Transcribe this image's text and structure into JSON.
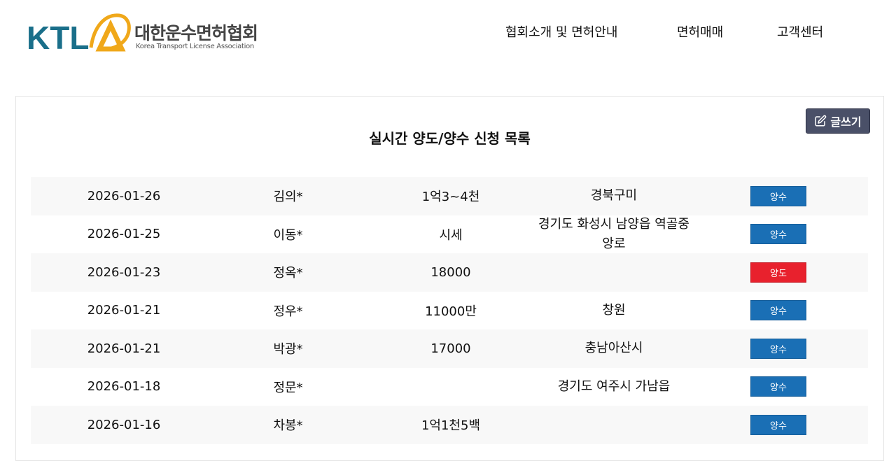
{
  "brand": {
    "mark_text": "KTL",
    "name_ko": "대한운수면허협회",
    "name_en": "Korea Transport License Association",
    "mark_blue": "#1a6f8a",
    "mark_gold": "#f0a81a"
  },
  "nav": {
    "items": [
      {
        "label": "협회소개 및 면허안내"
      },
      {
        "label": "면허매매"
      },
      {
        "label": "고객센터"
      }
    ]
  },
  "board": {
    "title": "실시간 양도/양수 신청 목록",
    "write_label": "글쓰기",
    "write_icon": "edit-icon",
    "colors": {
      "buy": "#1a6fb5",
      "sell": "#e8212d",
      "write_bg": "#4a5068"
    },
    "rows": [
      {
        "date": "2026-01-26",
        "name": "김의*",
        "price": "1억3~4천",
        "region": "경북구미",
        "type": "양수",
        "kind": "buy"
      },
      {
        "date": "2026-01-25",
        "name": "이동*",
        "price": "시세",
        "region": "경기도 화성시 남양읍 역골중\n앙로",
        "type": "양수",
        "kind": "buy"
      },
      {
        "date": "2026-01-23",
        "name": "정옥*",
        "price": "18000",
        "region": "",
        "type": "양도",
        "kind": "sell"
      },
      {
        "date": "2026-01-21",
        "name": "정우*",
        "price": "11000만",
        "region": "창원",
        "type": "양수",
        "kind": "buy"
      },
      {
        "date": "2026-01-21",
        "name": "박광*",
        "price": "17000",
        "region": "충남아산시",
        "type": "양수",
        "kind": "buy"
      },
      {
        "date": "2026-01-18",
        "name": "정문*",
        "price": "",
        "region": "경기도 여주시 가남읍",
        "type": "양수",
        "kind": "buy"
      },
      {
        "date": "2026-01-16",
        "name": "차봉*",
        "price": "1억1천5백",
        "region": "",
        "type": "양수",
        "kind": "buy"
      }
    ]
  }
}
